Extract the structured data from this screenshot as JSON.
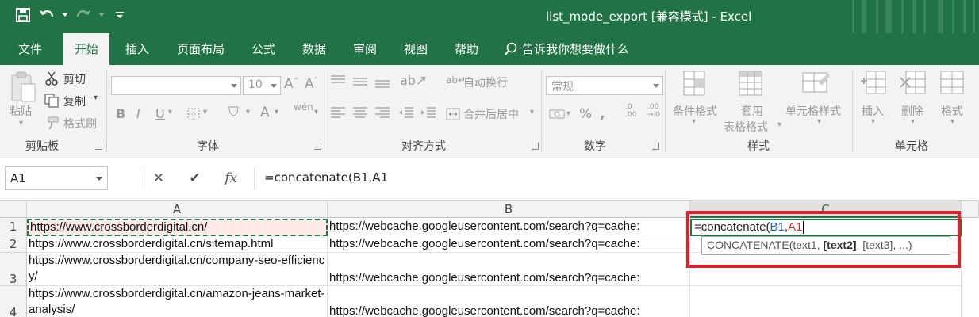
{
  "window": {
    "title": "list_mode_export  [兼容模式]  -  Excel"
  },
  "tabs": [
    "文件",
    "开始",
    "插入",
    "页面布局",
    "公式",
    "数据",
    "审阅",
    "视图",
    "帮助"
  ],
  "active_tab": "开始",
  "tell_me": "告诉我你想要做什么",
  "ribbon": {
    "clipboard": {
      "label": "剪贴板",
      "paste": "粘贴",
      "cut": "剪切",
      "copy": "复制",
      "format_painter": "格式刷"
    },
    "font": {
      "label": "字体",
      "font_name": "",
      "font_size": "10"
    },
    "alignment": {
      "label": "对齐方式",
      "wrap_text": "自动换行",
      "merge_center": "合并后居中"
    },
    "number": {
      "label": "数字",
      "format": "常规"
    },
    "styles": {
      "label": "样式",
      "conditional_format": "条件格式",
      "table_format_line1": "套用",
      "table_format_line2": "表格格式",
      "cell_styles": "单元格样式"
    },
    "cells": {
      "label": "单元格",
      "insert": "插入",
      "delete": "删除",
      "format": "格式"
    }
  },
  "formula_bar": {
    "name_box": "A1",
    "cancel_icon": "✕",
    "enter_icon": "✔",
    "fx_icon": "fx",
    "formula": "=concatenate(B1,A1"
  },
  "grid": {
    "columns": [
      "A",
      "B",
      "C"
    ],
    "rows": [
      {
        "num": "1",
        "a": "https://www.crossborderdigital.cn/",
        "b": "https://webcache.googleusercontent.com/search?q=cache:"
      },
      {
        "num": "2",
        "a": "https://www.crossborderdigital.cn/sitemap.html",
        "b": "https://webcache.googleusercontent.com/search?q=cache:"
      },
      {
        "num": "3",
        "a": "https://www.crossborderdigital.cn/company-seo-efficiency/",
        "b": "https://webcache.googleusercontent.com/search?q=cache:"
      },
      {
        "num": "4",
        "a": "https://www.crossborderdigital.cn/amazon-jeans-market-analysis/",
        "b": "https://webcache.googleusercontent.com/search?q=cache:"
      }
    ],
    "editing": {
      "prefix": "=concatenate(",
      "ref1": "B1",
      "comma": ",",
      "ref2": "A1"
    },
    "tooltip": {
      "fn": "CONCATENATE(text1, ",
      "bold": "[text2]",
      "rest": ", [text3], ...)"
    }
  },
  "colors": {
    "excel_green": "#217346",
    "highlight_red": "#d9232a",
    "ref_blue": "#2467c8",
    "ref_red": "#c0392b"
  }
}
